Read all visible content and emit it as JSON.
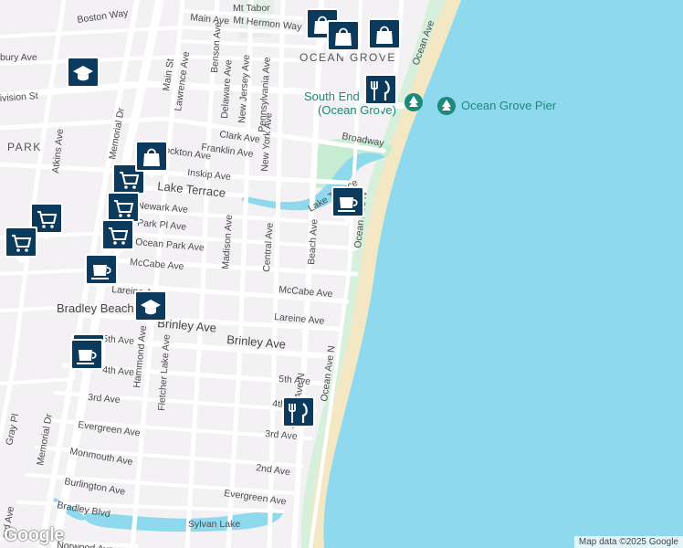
{
  "map": {
    "colors": {
      "land": "#f3f1f4",
      "water": "#8fd9ee",
      "sand": "#f4e7c4",
      "park": "#c6ecd2",
      "road": "#ffffff",
      "pin": "#0b3a5c"
    },
    "street_labels": [
      "Boston Way",
      "Main Ave",
      "Mt Tabor",
      "Mt Hermon Way",
      "bury Ave",
      "Main St",
      "Lawrence Ave",
      "Benson Ave",
      "Delaware Ave",
      "New Jersey Ave",
      "Pennsylvania Ave",
      "Clark Ave",
      "New York Ave",
      "Franklin Ave",
      "Stockton Ave",
      "Inskip Ave",
      "Lake Terrace",
      "Lake Terrace",
      "Newark Ave",
      "Park Pl Ave",
      "Ocean Park Ave",
      "McCabe Ave",
      "McCabe Ave",
      "Lareine Ave",
      "Lareine Ave",
      "Brinley Ave",
      "Brinley Ave",
      "5th Ave",
      "5th Ave",
      "4th Ave",
      "4th Ave",
      "3rd Ave",
      "3rd Ave",
      "2nd Ave",
      "Evergreen Ave",
      "Evergreen Ave",
      "Monmouth Ave",
      "Burlington Ave",
      "Bradley Blvd",
      "Norwood Ave",
      "Broadway",
      "Madison Ave",
      "Central Ave",
      "Beach Ave",
      "Ocean Ave N",
      "Ocean Ave N",
      "Ocean Ave N",
      "Ocean Ave",
      "Atkins Ave",
      "Memorial Dr",
      "Memorial Dr",
      "Fletcher Lake Ave",
      "Hammond Ave",
      "Gray Pl",
      "ivision St",
      "Sylvan Lake",
      "ard Ave"
    ],
    "area_labels": [
      "OCEAN GROVE",
      "PARK"
    ],
    "place_labels": [
      "Bradley Beach"
    ],
    "poi_labels": [
      "South End",
      "(Ocean Grove)",
      "Ocean Grove Pier"
    ],
    "markers": [
      {
        "type": "school",
        "icon": "graduation-cap-icon"
      },
      {
        "type": "school",
        "icon": "graduation-cap-icon"
      },
      {
        "type": "shopping",
        "icon": "shopping-bag-icon"
      },
      {
        "type": "shopping",
        "icon": "shopping-bag-icon"
      },
      {
        "type": "shopping",
        "icon": "shopping-bag-icon"
      },
      {
        "type": "grocery",
        "icon": "shopping-cart-icon"
      },
      {
        "type": "grocery",
        "icon": "shopping-cart-icon"
      },
      {
        "type": "grocery",
        "icon": "shopping-cart-icon"
      },
      {
        "type": "grocery",
        "icon": "shopping-cart-icon"
      },
      {
        "type": "grocery",
        "icon": "shopping-cart-icon"
      },
      {
        "type": "cafe",
        "icon": "coffee-cup-icon"
      },
      {
        "type": "cafe",
        "icon": "coffee-cup-icon"
      },
      {
        "type": "cafe",
        "icon": "coffee-cup-icon"
      },
      {
        "type": "restaurant",
        "icon": "fork-knife-icon"
      },
      {
        "type": "restaurant",
        "icon": "fork-knife-icon"
      },
      {
        "type": "park",
        "icon": "tree-icon"
      },
      {
        "type": "park",
        "icon": "tree-icon"
      }
    ],
    "attribution": "Map data ©2025 Google",
    "logo": "Google"
  }
}
